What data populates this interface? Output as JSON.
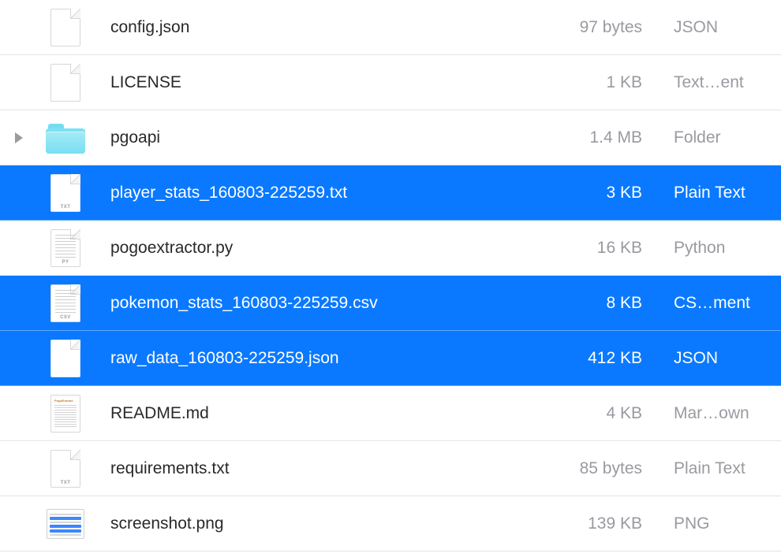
{
  "rows": [
    {
      "name": "config.json",
      "size": "97 bytes",
      "kind": "JSON",
      "icon": "file-blank",
      "selected": false,
      "folder": false
    },
    {
      "name": "LICENSE",
      "size": "1 KB",
      "kind": "Text…ent",
      "icon": "file-blank",
      "selected": false,
      "folder": false
    },
    {
      "name": "pgoapi",
      "size": "1.4 MB",
      "kind": "Folder",
      "icon": "folder",
      "selected": false,
      "folder": true
    },
    {
      "name": "player_stats_160803-225259.txt",
      "size": "3 KB",
      "kind": "Plain Text",
      "icon": "file-blank",
      "badge": "TXT",
      "selected": true,
      "folder": false
    },
    {
      "name": "pogoextractor.py",
      "size": "16 KB",
      "kind": "Python",
      "icon": "file-text",
      "badge": "PY",
      "selected": false,
      "folder": false
    },
    {
      "name": "pokemon_stats_160803-225259.csv",
      "size": "8 KB",
      "kind": "CS…ment",
      "icon": "file-text",
      "badge": "CSV",
      "selected": true,
      "folder": false
    },
    {
      "name": "raw_data_160803-225259.json",
      "size": "412 KB",
      "kind": "JSON",
      "icon": "file-blank",
      "selected": true,
      "folder": false
    },
    {
      "name": "README.md",
      "size": "4 KB",
      "kind": "Mar…own",
      "icon": "file-md",
      "selected": false,
      "folder": false
    },
    {
      "name": "requirements.txt",
      "size": "85 bytes",
      "kind": "Plain Text",
      "icon": "file-blank",
      "badge": "TXT",
      "selected": false,
      "folder": false
    },
    {
      "name": "screenshot.png",
      "size": "139 KB",
      "kind": "PNG",
      "icon": "thumb",
      "selected": false,
      "folder": false
    }
  ]
}
